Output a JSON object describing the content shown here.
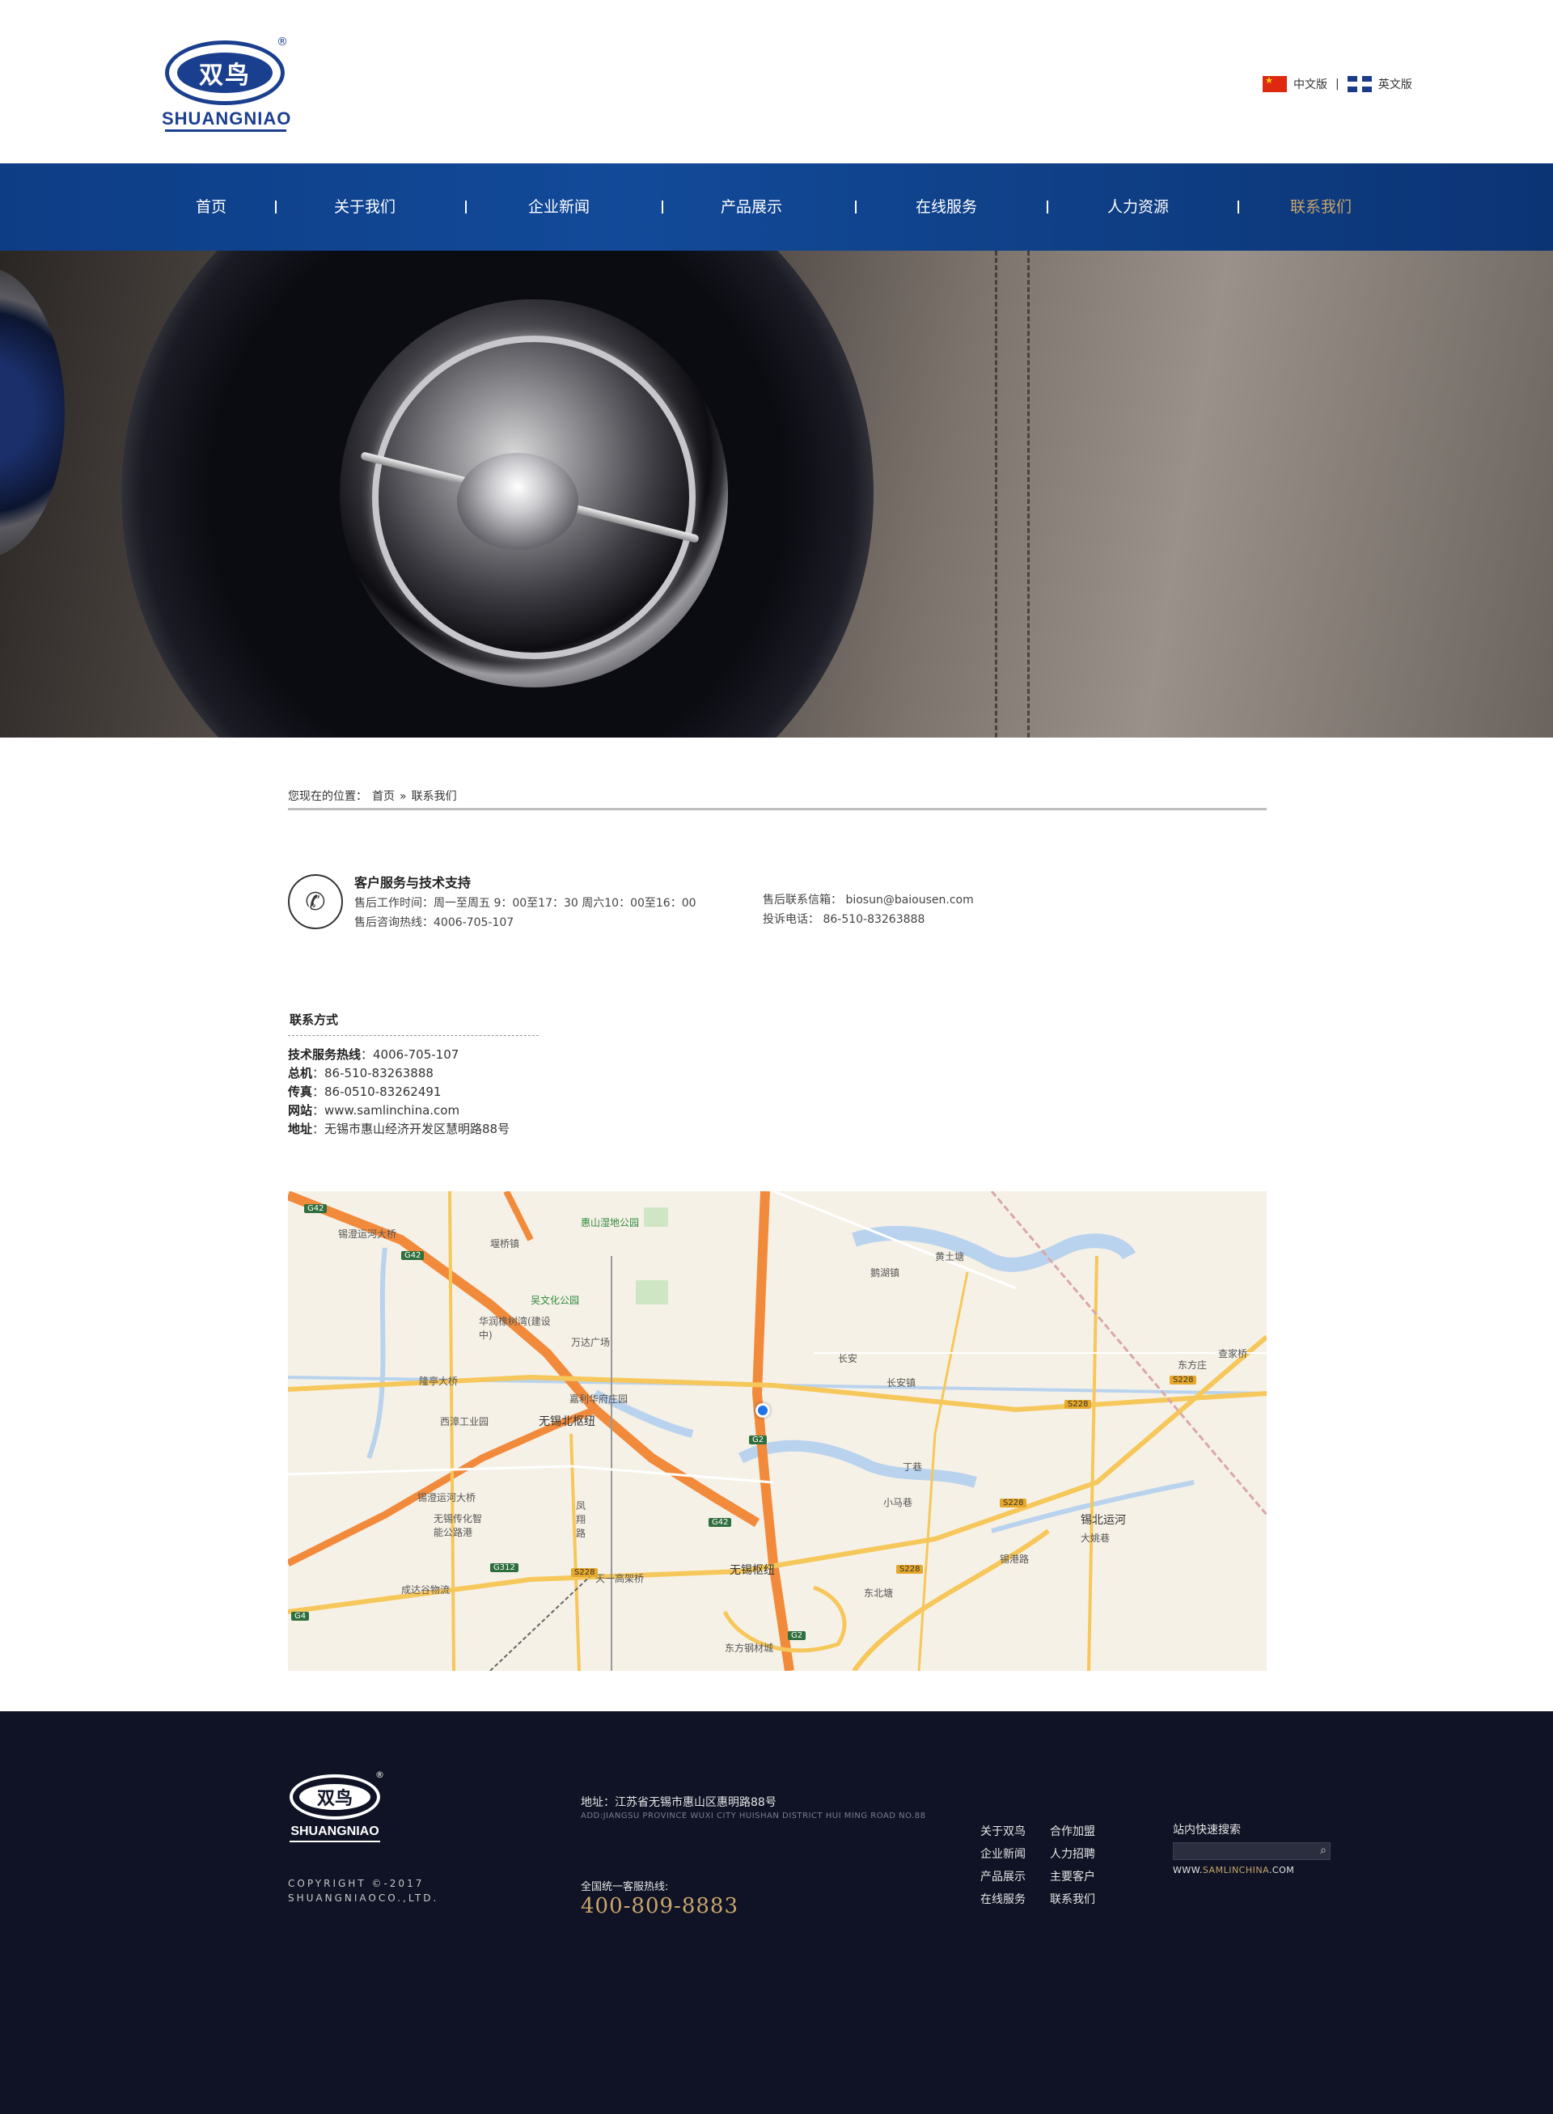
{
  "header": {
    "logo_cn": "双鸟",
    "logo_en": "SHUANGNIAO",
    "logo_reg": "®",
    "lang_cn": "中文版",
    "lang_sep": "|",
    "lang_en": "英文版"
  },
  "nav": {
    "items": [
      {
        "label": "首页"
      },
      {
        "label": "关于我们"
      },
      {
        "label": "企业新闻"
      },
      {
        "label": "产品展示"
      },
      {
        "label": "在线服务"
      },
      {
        "label": "人力资源"
      },
      {
        "label": "联系我们"
      }
    ],
    "active_index": 6,
    "active_color": "#c8a56b",
    "bg_color": "#124a99"
  },
  "breadcrumb": {
    "prefix": "您现在的位置：",
    "home": "首页",
    "sep": "»",
    "current": "联系我们"
  },
  "service": {
    "icon": "phone-icon",
    "title": "客户服务与技术支持",
    "hours": "售后工作时间：周一至周五 9：00至17：30   周六10：00至16：00",
    "hotline": "售后咨询热线：4006-705-107",
    "mail": "售后联系信箱： biosun@baiousen.com",
    "complaint": "投诉电话： 86-510-83263888"
  },
  "contact": {
    "title": "联系方式",
    "rows": [
      {
        "label": "技术服务热线",
        "value": "：4006-705-107"
      },
      {
        "label": "总机",
        "value": "：86-510-83263888"
      },
      {
        "label": "传真",
        "value": "：86-0510-83262491"
      },
      {
        "label": "网站",
        "value": "：www.samlinchina.com"
      },
      {
        "label": "地址",
        "value": "：无锡市惠山经济开发区慧明路88号"
      }
    ]
  },
  "map": {
    "labels": {
      "l1": "锡澄运河大桥",
      "l2": "惠山湿地公园",
      "l3": "堰桥镇",
      "l4": "吴文化公园",
      "l5": "华润橡树湾(建设中)",
      "l6": "万达广场",
      "l7": "隆亭大桥",
      "l8": "嘉利华府庄园",
      "l9": "西漳工业园",
      "l10": "无锡北枢纽",
      "l11": "锡澄运河大桥",
      "l12": "无锡传化智能公路港",
      "l13": "凤翔路",
      "l14": "天一高架桥",
      "l15": "无锡枢纽",
      "l16": "成达谷物流",
      "l17": "东方钢材城",
      "l18": "长安镇",
      "l19": "锡北运河",
      "l20": "锡港路",
      "l21": "东北塘",
      "l22": "长安",
      "l23": "鹅湖镇",
      "l24": "查家桥",
      "l25": "东方庄",
      "l26": "大姚巷",
      "l27": "丁巷",
      "l28": "黄土塘",
      "l29": "小马巷"
    },
    "badges": {
      "g42a": "G42",
      "g42b": "G42",
      "g42c": "G42",
      "g2a": "G2",
      "g2b": "G2",
      "g312": "G312",
      "s228a": "S228",
      "s228b": "S228",
      "s228c": "S228",
      "s228d": "S228",
      "s228e": "S228",
      "g4a": "G4"
    },
    "marker_color": "#1e73e8"
  },
  "footer": {
    "logo_cn": "双鸟",
    "logo_en": "SHUANGNIAO",
    "logo_reg": "®",
    "copyright": "COPYRIGHT ©-2017",
    "company": "SHUANGNIAOCO.,LTD.",
    "address": "地址：江苏省无锡市惠山区惠明路88号",
    "address_en": "ADD:JIANGSU PROVINCE WUXI CITY HUISHAN DISTRICT HUI MING ROAD NO.88",
    "hotline_label": "全国统一客服热线:",
    "hotline": "400-809-8883",
    "links": [
      {
        "label": "关于双鸟"
      },
      {
        "label": "合作加盟"
      },
      {
        "label": "企业新闻"
      },
      {
        "label": "人力招聘"
      },
      {
        "label": "产品展示"
      },
      {
        "label": "主要客户"
      },
      {
        "label": "在线服务"
      },
      {
        "label": "联系我们"
      }
    ],
    "search_title": "站内快速搜索",
    "search_placeholder": "",
    "site_prefix": "WWW.",
    "site_mid": "SAMLINCHINA",
    "site_suffix": ".COM"
  }
}
